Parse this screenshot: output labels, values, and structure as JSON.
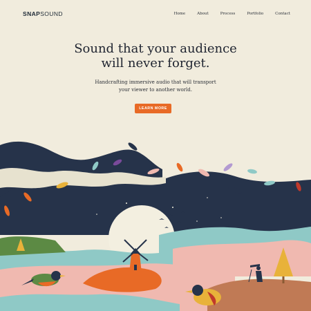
{
  "brand": {
    "bold": "SNAP",
    "light": "SOUND"
  },
  "nav": {
    "items": [
      "Home",
      "About",
      "Process",
      "Portfolio",
      "Contact"
    ]
  },
  "hero": {
    "title_line1": "Sound that your audience",
    "title_line2": "will never forget.",
    "subtitle_line1": "Handcrafting immersive audio that will transport",
    "subtitle_line2": "your viewer to another world.",
    "cta_label": "LEARN MORE"
  },
  "colors": {
    "background": "#f1ecdd",
    "accent": "#e86a26",
    "navy": "#26334a",
    "teal": "#8fc9c6",
    "pink": "#f0b9b0",
    "green": "#5c8a44"
  },
  "icons": [
    "windmill-icon",
    "bird-icon",
    "photographer-icon",
    "tree-icon",
    "leaf-icon"
  ]
}
